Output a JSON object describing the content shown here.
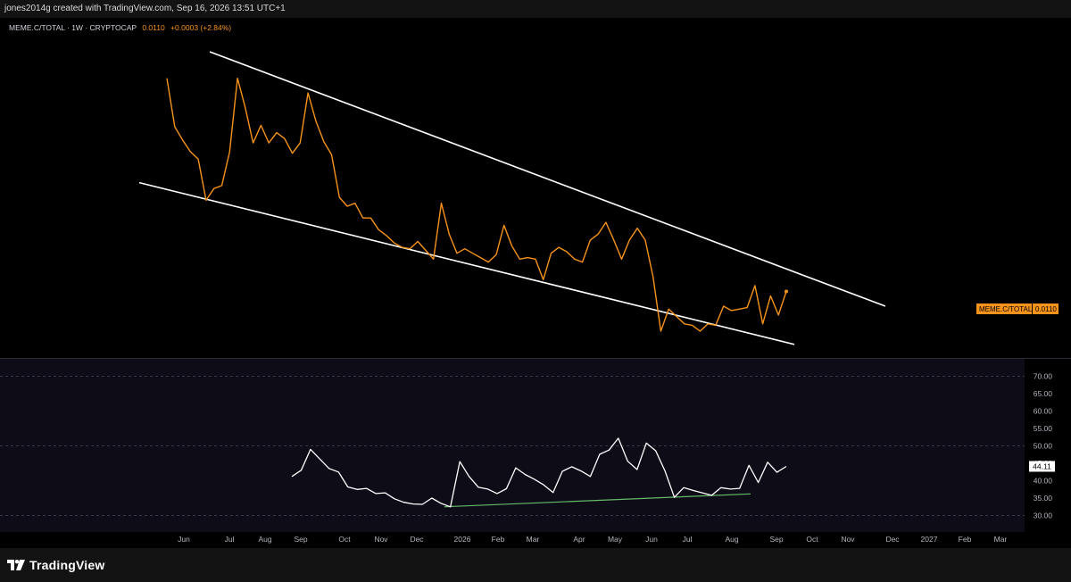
{
  "header": {
    "attribution": "jones2014g created with TradingView.com, Sep 16, 2026 13:51 UTC+1"
  },
  "footer": {
    "brand": "TradingView"
  },
  "legend": {
    "symbol": "MEME.C/TOTAL · 1W · CRYPTOCAP",
    "value": "0.0110",
    "change": "+0.0003 (+2.84%)"
  },
  "colors": {
    "background": "#000000",
    "price_line": "#f7931a",
    "rsi_line": "#ffffff",
    "trendline": "#ffffff",
    "divergence_line": "#66bb6a",
    "rsi_pane": "#0d0c17"
  },
  "chart_data": [
    {
      "type": "line",
      "title": "MEME.C/TOTAL · 1W · CRYPTOCAP",
      "price_label": {
        "name": "MEME.C/TOTAL",
        "value": "0.0110"
      },
      "x_tick_labels": [
        "Jun",
        "Jul",
        "Aug",
        "Sep",
        "Oct",
        "Nov",
        "Dec",
        "2026",
        "Feb",
        "Mar",
        "Apr",
        "May",
        "Jun",
        "Jul",
        "Aug",
        "Sep",
        "Oct",
        "Nov",
        "Dec",
        "2027",
        "Feb",
        "Mar"
      ],
      "series": [
        {
          "values": [
            0.0255,
            0.0222,
            0.0213,
            0.0205,
            0.02,
            0.0172,
            0.018,
            0.0182,
            0.0205,
            0.0255,
            0.0235,
            0.0211,
            0.0223,
            0.0211,
            0.0218,
            0.0214,
            0.0204,
            0.0211,
            0.0245,
            0.0226,
            0.0212,
            0.0203,
            0.0174,
            0.0168,
            0.017,
            0.016,
            0.016,
            0.0152,
            0.0148,
            0.0143,
            0.014,
            0.0139,
            0.0144,
            0.0138,
            0.0132,
            0.017,
            0.0149,
            0.0136,
            0.0139,
            0.0136,
            0.0133,
            0.013,
            0.0135,
            0.0155,
            0.0141,
            0.0132,
            0.0133,
            0.0132,
            0.0118,
            0.0136,
            0.014,
            0.0137,
            0.0132,
            0.013,
            0.0145,
            0.0149,
            0.0157,
            0.0145,
            0.0132,
            0.0145,
            0.0153,
            0.0145,
            0.012,
            0.0083,
            0.0098,
            0.0093,
            0.0088,
            0.0087,
            0.0083,
            0.0088,
            0.0087,
            0.01,
            0.0097,
            0.0098,
            0.0099,
            0.0114,
            0.0088,
            0.0107,
            0.0094,
            0.011
          ]
        }
      ],
      "trendlines": [
        {
          "name": "upper-channel",
          "points": [
            [
              0.0273,
              "Jun"
            ],
            [
              0.01,
              "Dec"
            ]
          ]
        },
        {
          "name": "lower-channel",
          "points": [
            [
              0.0184,
              "May"
            ],
            [
              0.0074,
              "Nov"
            ]
          ]
        }
      ]
    },
    {
      "type": "line",
      "y_tick_labels": [
        "70.00",
        "65.00",
        "60.00",
        "55.00",
        "50.00",
        "45.00",
        "40.00",
        "35.00",
        "30.00"
      ],
      "ylim": [
        30,
        70
      ],
      "last_value_label": "44.11",
      "series": [
        {
          "values": [
            41.2,
            43.0,
            49.0,
            46.2,
            43.5,
            42.5,
            38.2,
            37.5,
            37.8,
            36.3,
            36.5,
            34.8,
            33.8,
            33.3,
            33.2,
            35.0,
            33.5,
            32.5,
            45.5,
            41.2,
            38.1,
            37.6,
            36.3,
            37.7,
            43.7,
            41.8,
            40.4,
            38.8,
            36.6,
            42.7,
            44.0,
            42.8,
            41.2,
            47.6,
            48.8,
            52.2,
            45.6,
            43.2,
            50.8,
            48.6,
            42.8,
            35.2,
            38.0,
            37.2,
            36.5,
            35.8,
            38.0,
            37.6,
            37.8,
            44.4,
            39.5,
            45.3,
            42.4,
            44.11
          ]
        }
      ],
      "divergence_line": [
        [
          32.5,
          "Dec"
        ],
        [
          36.2,
          "Aug"
        ]
      ]
    }
  ]
}
